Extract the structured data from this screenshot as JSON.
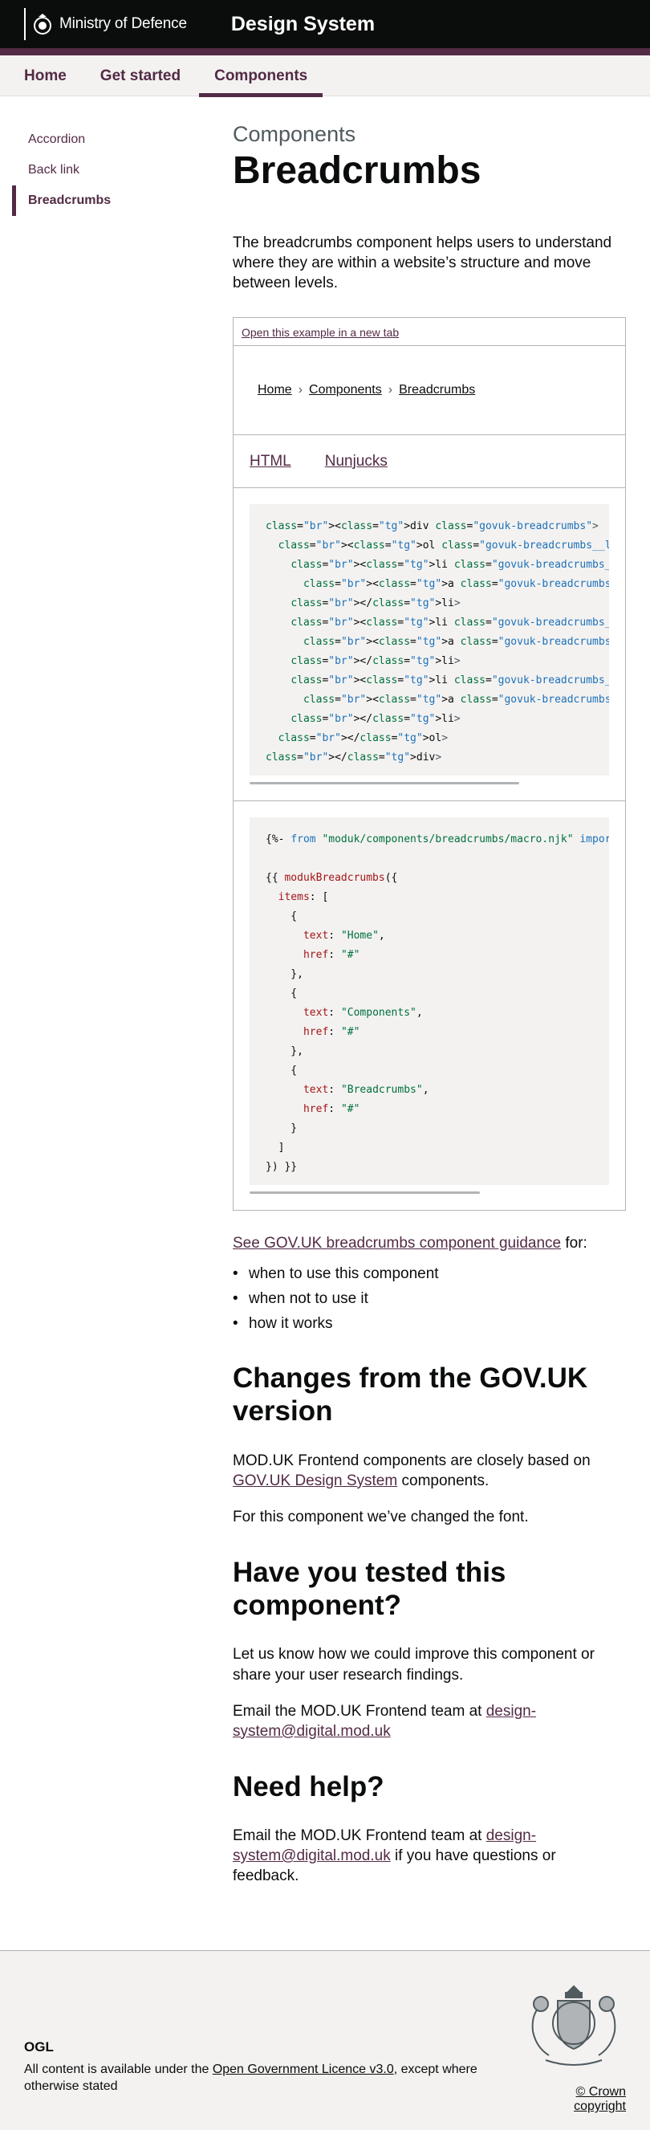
{
  "header": {
    "org_name": "Ministry of Defence",
    "service_name": "Design System"
  },
  "nav": {
    "items": [
      "Home",
      "Get started",
      "Components"
    ],
    "active": "Components"
  },
  "sidebar": {
    "items": [
      "Accordion",
      "Back link",
      "Breadcrumbs"
    ],
    "active": "Breadcrumbs"
  },
  "page": {
    "caption": "Components",
    "title": "Breadcrumbs",
    "lead": "The breadcrumbs component helps users to understand where they are within a website’s structure and move between levels."
  },
  "example": {
    "open_link": "Open this example in a new tab",
    "breadcrumbs": [
      "Home",
      "Components",
      "Breadcrumbs"
    ],
    "tabs": [
      "HTML",
      "Nunjucks"
    ],
    "html_code": [
      "<div class=\"govuk-breadcrumbs\">",
      "  <ol class=\"govuk-breadcrumbs__list\">",
      "    <li class=\"govuk-breadcrumbs__list-item\">",
      "      <a class=\"govuk-breadcrumbs__link\" href=\"#\">Home</a>",
      "    </li>",
      "    <li class=\"govuk-breadcrumbs__list-item\">",
      "      <a class=\"govuk-breadcrumbs__link\" href=\"#\">Components</a>",
      "    </li>",
      "    <li class=\"govuk-breadcrumbs__list-item\">",
      "      <a class=\"govuk-breadcrumbs__link\" href=\"#\">Breadcrumbs</a>",
      "    </li>",
      "  </ol>",
      "</div>"
    ],
    "nunjucks_code": [
      "{%- from \"moduk/components/breadcrumbs/macro.njk\" import modukBreadcrumbs -%}",
      "",
      "{{ modukBreadcrumbs({",
      "  items: [",
      "    {",
      "      text: \"Home\",",
      "      href: \"#\"",
      "    },",
      "    {",
      "      text: \"Components\",",
      "      href: \"#\"",
      "    },",
      "    {",
      "      text: \"Breadcrumbs\",",
      "      href: \"#\"",
      "    }",
      "  ]",
      "}) }}"
    ]
  },
  "guidance": {
    "link": "See GOV.UK breadcrumbs component guidance",
    "suffix": " for:",
    "bullets": [
      "when to use this component",
      "when not to use it",
      "how it works"
    ]
  },
  "changes": {
    "heading": "Changes from the GOV.UK version",
    "p1_before": "MOD.UK Frontend components are closely based on ",
    "p1_link": "GOV.UK Design System",
    "p1_after": " components.",
    "p2": "For this component we’ve changed the font."
  },
  "tested": {
    "heading": "Have you tested this component?",
    "p1": "Let us know how we could improve this component or share your user research findings.",
    "p2_before": "Email the MOD.UK Frontend team at ",
    "email": "design-system@digital.mod.uk"
  },
  "help": {
    "heading": "Need help?",
    "p_before": "Email the MOD.UK Frontend team at ",
    "email": "design-system@digital.mod.uk",
    "p_after": " if you have questions or feedback."
  },
  "footer": {
    "ogl_label": "OGL",
    "licence_before": "All content is available under the ",
    "licence_link": "Open Government Licence v3.0",
    "licence_after": ", except where otherwise stated",
    "copyright": "© Crown copyright"
  },
  "colors": {
    "brand": "#532a45",
    "header_bg": "#0b0c0c",
    "footer_bg": "#f3f2f1"
  }
}
